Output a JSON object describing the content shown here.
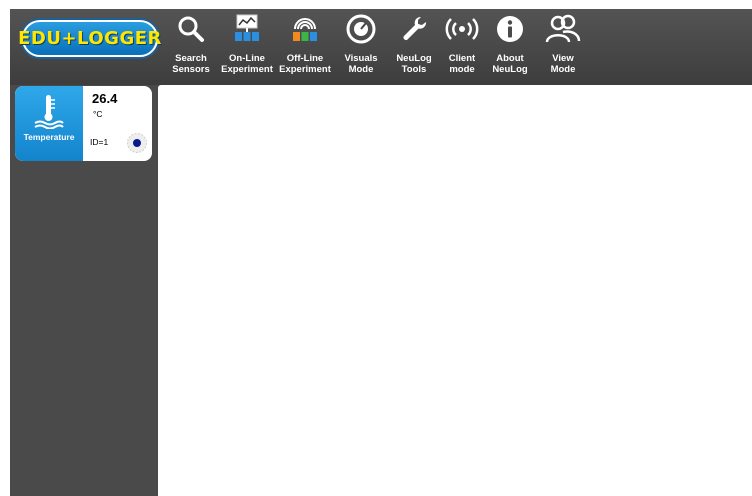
{
  "app": {
    "logo_text": "EDU+LOGGER",
    "brand_color": "#1a8ad6",
    "logo_text_color": "#ffe600"
  },
  "toolbar": {
    "items": [
      {
        "line1": "Search",
        "line2": "Sensors",
        "icon": "search-icon"
      },
      {
        "line1": "On-Line",
        "line2": "Experiment",
        "icon": "online-experiment-icon"
      },
      {
        "line1": "Off-Line",
        "line2": "Experiment",
        "icon": "offline-experiment-icon"
      },
      {
        "line1": "Visuals",
        "line2": "Mode",
        "icon": "visuals-mode-icon"
      },
      {
        "line1": "NeuLog",
        "line2": "Tools",
        "icon": "wrench-icon"
      },
      {
        "line1": "Client",
        "line2": "mode",
        "icon": "broadcast-icon"
      },
      {
        "line1": "About",
        "line2": "NeuLog",
        "icon": "info-icon"
      },
      {
        "line1": "View",
        "line2": "Mode",
        "icon": "users-icon"
      }
    ]
  },
  "sensor": {
    "name": "Temperature",
    "value": "26.4",
    "unit": "°C",
    "id_text": "ID=1",
    "icon": "thermometer-icon"
  }
}
